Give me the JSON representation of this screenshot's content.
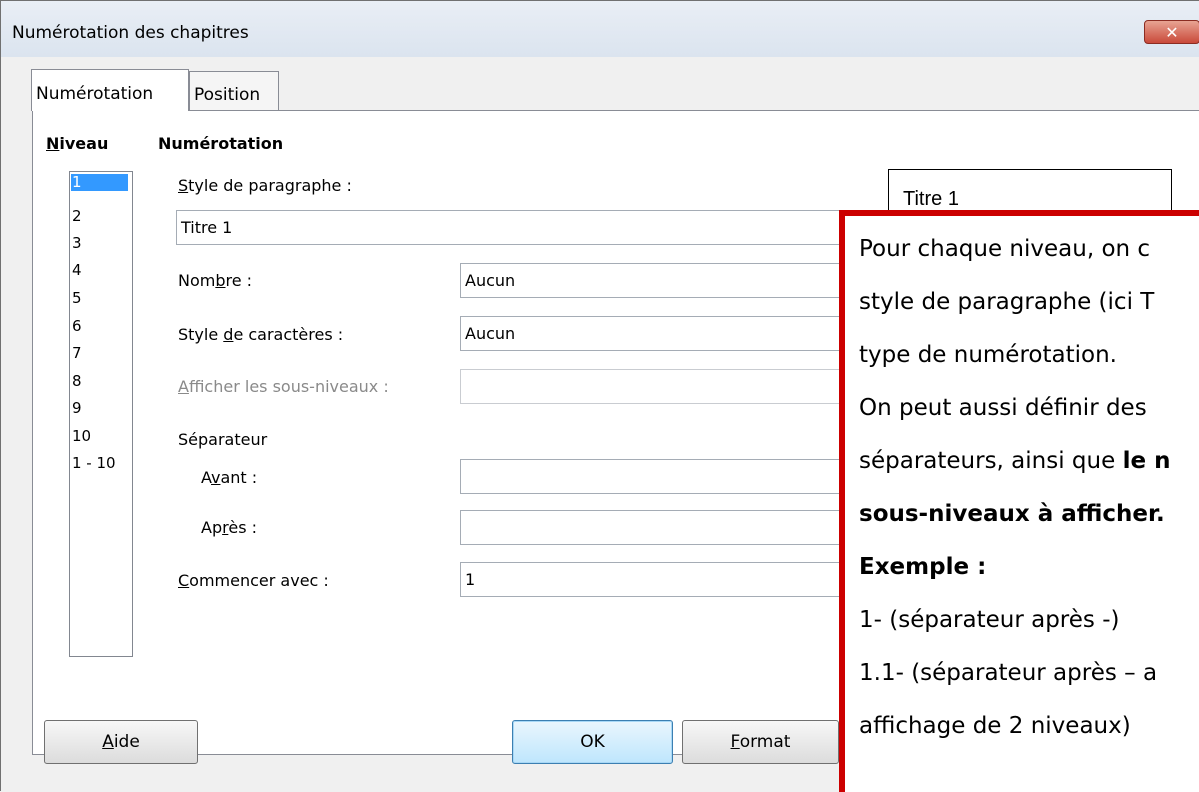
{
  "window": {
    "title": "Numérotation des chapitres",
    "close_glyph": "✕"
  },
  "tabs": [
    {
      "label": "Numérotation"
    },
    {
      "label": "Position"
    }
  ],
  "niveau": {
    "heading_first": "N",
    "heading_rest": "iveau",
    "items": [
      "1",
      "2",
      "3",
      "4",
      "5",
      "6",
      "7",
      "8",
      "9",
      "10",
      "1 - 10"
    ],
    "selected": 0
  },
  "numerotation": {
    "heading": "Numérotation",
    "style_paragraphe_label_u": "S",
    "style_paragraphe_label_rest": "tyle de paragraphe :",
    "style_paragraphe_value": "Titre 1",
    "nombre_label_a": "Nom",
    "nombre_label_u": "b",
    "nombre_label_b": "re :",
    "nombre_value": "Aucun",
    "style_car_label_a": "Style ",
    "style_car_label_u": "d",
    "style_car_label_b": "e caractères :",
    "style_car_value": "Aucun",
    "sous_niveaux_label_u": "A",
    "sous_niveaux_label_rest": "fficher les sous-niveaux :",
    "separateur_label": "Séparateur",
    "avant_label_a": "A",
    "avant_label_u": "v",
    "avant_label_b": "ant :",
    "apres_label_a": "Ap",
    "apres_label_u": "r",
    "apres_label_b": "ès :",
    "commencer_label_u": "C",
    "commencer_label_rest": "ommencer avec :",
    "commencer_value": "1"
  },
  "preview": {
    "text": "Titre 1"
  },
  "buttons": {
    "aide_u": "A",
    "aide_rest": "ide",
    "ok": "OK",
    "format_u": "F",
    "format_rest": "ormat"
  },
  "callout": {
    "line1": "Pour chaque niveau, on c",
    "line2": "style de paragraphe (ici T",
    "line3": "type de numérotation.",
    "line4": "On peut aussi définir des",
    "line5_a": "séparateurs, ainsi que ",
    "line5_b": "le n",
    "line6": "sous-niveaux à afficher.",
    "line7": "Exemple :",
    "line8": "1-   (séparateur après -)",
    "line9": "1.1- (séparateur après – a",
    "line10": "affichage de 2 niveaux)"
  }
}
